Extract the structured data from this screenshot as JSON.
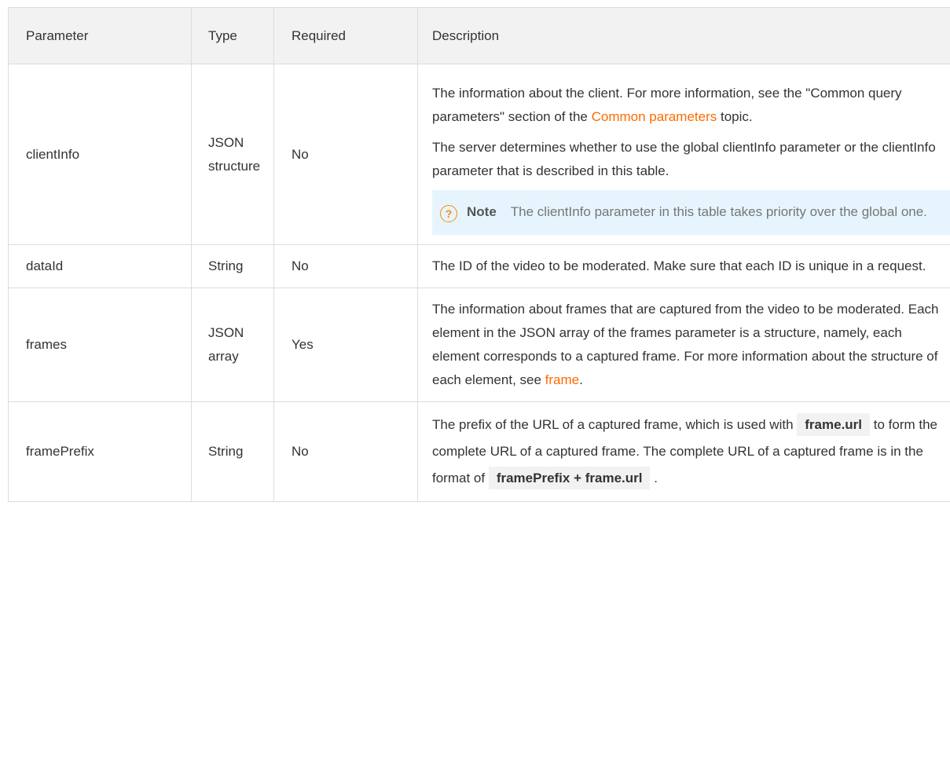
{
  "header": {
    "parameter": "Parameter",
    "type": "Type",
    "required": "Required",
    "description": "Description"
  },
  "rows": [
    {
      "name": "clientInfo",
      "type": "JSON structure",
      "required": "No",
      "desc1_a": "The information about the client. For more information, see the \"Common query parameters\" section of the ",
      "desc1_link": "Common parameters",
      "desc1_b": " topic.",
      "desc2": "The server determines whether to use the global clientInfo parameter or the clientInfo parameter that is described in this table.",
      "note_icon": "?",
      "note_label": "Note",
      "note_text": "The clientInfo parameter in this table takes priority over the global one."
    },
    {
      "name": "dataId",
      "type": "String",
      "required": "No",
      "desc": "The ID of the video to be moderated. Make sure that each ID is unique in a request."
    },
    {
      "name": "frames",
      "type": "JSON array",
      "required": "Yes",
      "desc_a": "The information about frames that are captured from the video to be moderated. Each element in the JSON array of the frames parameter is a structure, namely, each element corresponds to a captured frame. For more information about the structure of each element, see ",
      "desc_link": "frame",
      "desc_b": "."
    },
    {
      "name": "framePrefix",
      "type": "String",
      "required": "No",
      "desc_a": "The prefix of the URL of a captured frame, which is used with ",
      "code1": "frame.url",
      "desc_b": " to form the complete URL of a captured frame. The complete URL of a captured frame is in the format of ",
      "code2": "framePrefix + frame.url",
      "desc_c": " ."
    }
  ],
  "colors": {
    "link": "#ff6a00",
    "note_bg": "#e6f5fd",
    "header_bg": "#f2f2f2",
    "border": "#dcdcdc"
  }
}
